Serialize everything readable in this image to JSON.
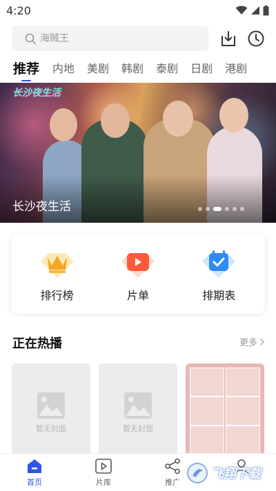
{
  "status_bar": {
    "time": "4:20"
  },
  "search": {
    "placeholder": "海贼王"
  },
  "tabs": [
    {
      "label": "推荐",
      "active": true
    },
    {
      "label": "内地"
    },
    {
      "label": "美剧"
    },
    {
      "label": "韩剧"
    },
    {
      "label": "泰剧"
    },
    {
      "label": "日剧"
    },
    {
      "label": "港剧"
    }
  ],
  "banner": {
    "title": "长沙夜生活",
    "logo_text": "长沙夜生活",
    "page_count": 6,
    "active_index": 2
  },
  "entries": [
    {
      "label": "排行榜",
      "icon": "crown-icon",
      "color": "#f5a623"
    },
    {
      "label": "片单",
      "icon": "play-list-icon",
      "color": "#ff5a3c"
    },
    {
      "label": "排期表",
      "icon": "calendar-check-icon",
      "color": "#2f8cf5"
    }
  ],
  "now_playing": {
    "title": "正在热播",
    "more": "更多",
    "cards": [
      {
        "placeholder": "暂无封面"
      },
      {
        "placeholder": "暂无封面"
      },
      {
        "poster": true
      }
    ]
  },
  "bottom_nav": [
    {
      "label": "首页",
      "icon": "home-icon",
      "active": true
    },
    {
      "label": "片库",
      "icon": "play-library-icon"
    },
    {
      "label": "推广",
      "icon": "share-icon"
    },
    {
      "label": "",
      "icon": "profile-icon"
    }
  ],
  "watermark": {
    "text": "飞翔下载"
  },
  "colors": {
    "accent": "#2f54eb",
    "tab_indicator": "#2f4ee0"
  }
}
